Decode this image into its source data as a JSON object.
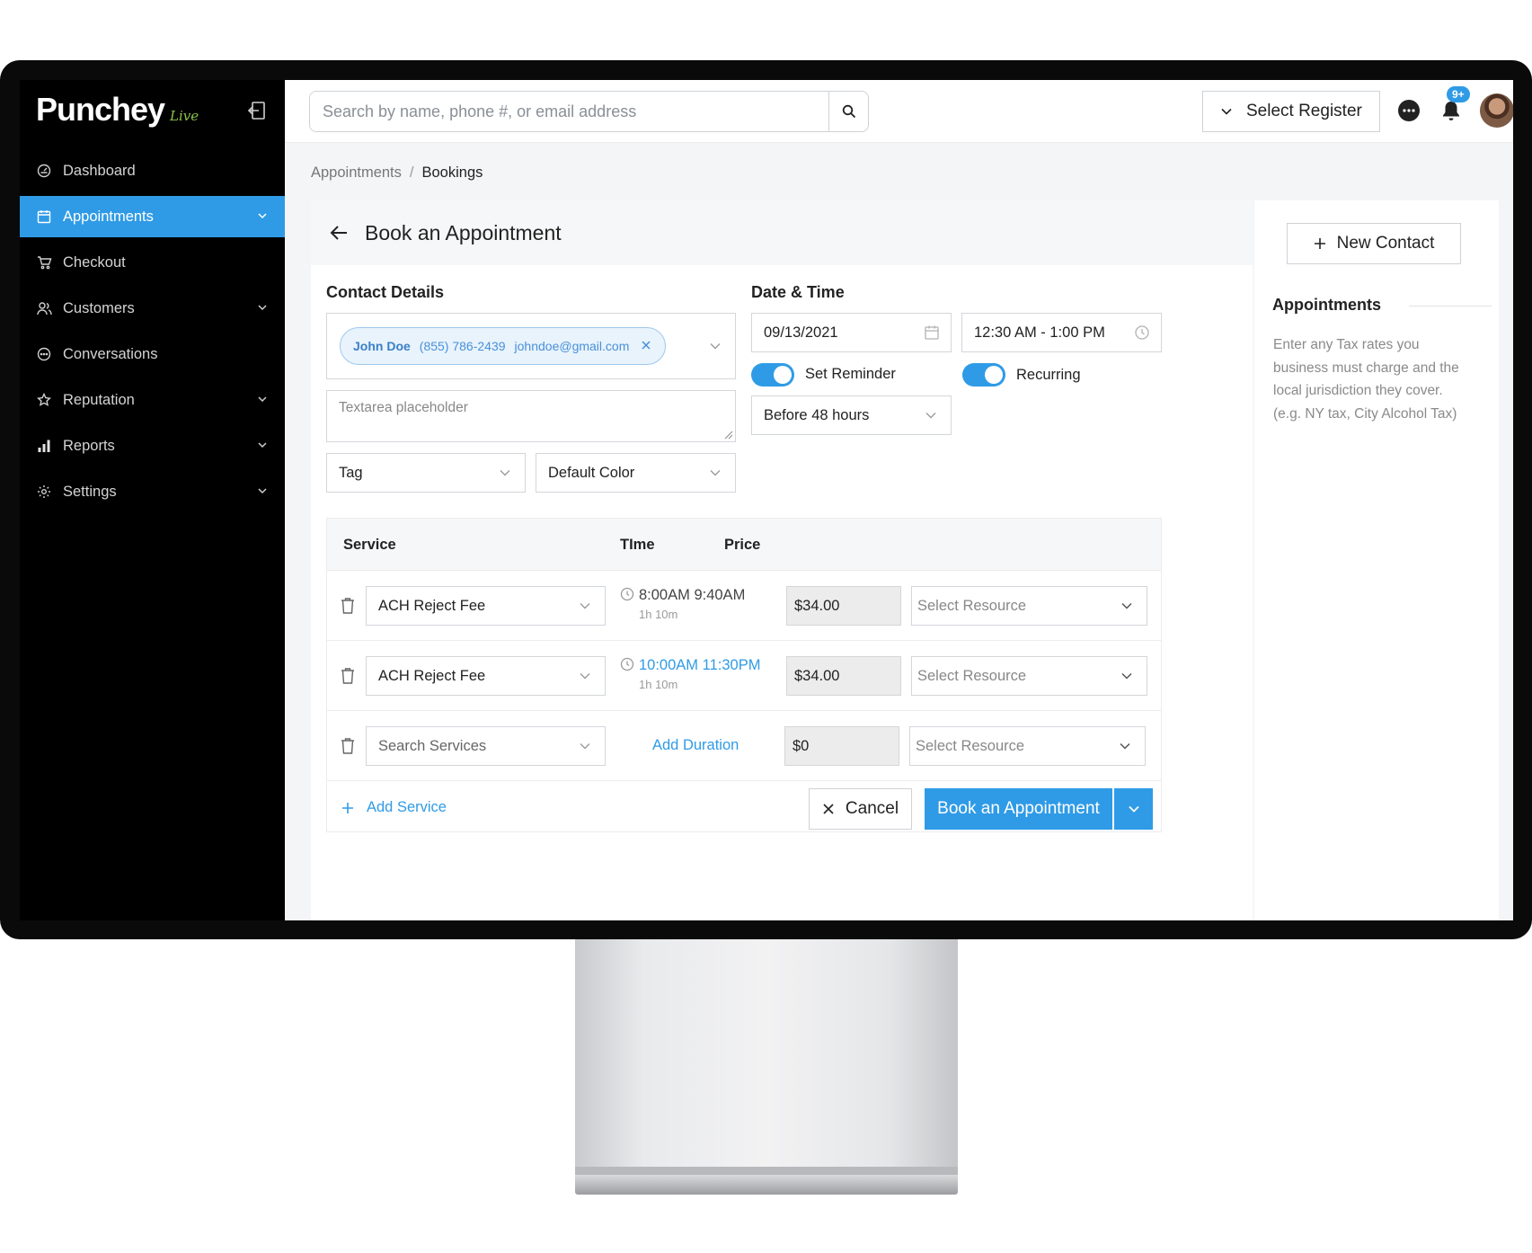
{
  "brand": {
    "name": "Punchey",
    "tag": "Live"
  },
  "sidebar": {
    "items": [
      {
        "label": "Dashboard",
        "icon": "dashboard-icon",
        "active": false,
        "expandable": false
      },
      {
        "label": "Appointments",
        "icon": "calendar-icon",
        "active": true,
        "expandable": true
      },
      {
        "label": "Checkout",
        "icon": "cart-icon",
        "active": false,
        "expandable": false
      },
      {
        "label": "Customers",
        "icon": "users-icon",
        "active": false,
        "expandable": true
      },
      {
        "label": "Conversations",
        "icon": "chat-icon",
        "active": false,
        "expandable": false
      },
      {
        "label": "Reputation",
        "icon": "star-icon",
        "active": false,
        "expandable": true
      },
      {
        "label": "Reports",
        "icon": "bar-chart-icon",
        "active": false,
        "expandable": true
      },
      {
        "label": "Settings",
        "icon": "gear-icon",
        "active": false,
        "expandable": true
      }
    ]
  },
  "topbar": {
    "search_placeholder": "Search by name, phone #, or email address",
    "register_label": "Select Register",
    "notifications_badge": "9+"
  },
  "breadcrumb": {
    "parent": "Appointments",
    "separator": "/",
    "current": "Bookings"
  },
  "page": {
    "title": "Book an Appointment"
  },
  "contact": {
    "section_title": "Contact Details",
    "chip": {
      "name": "John Doe",
      "phone": "(855) 786-2439",
      "email": "johndoe@gmail.com"
    },
    "textarea_placeholder": "Textarea placeholder",
    "tag_label": "Tag",
    "color_label": "Default Color"
  },
  "datetime": {
    "section_title": "Date & Time",
    "date": "09/13/2021",
    "time_range": "12:30 AM - 1:00 PM",
    "set_reminder_label": "Set Reminder",
    "set_reminder_on": true,
    "recurring_label": "Recurring",
    "recurring_on": true,
    "reminder_option": "Before 48 hours"
  },
  "services": {
    "headers": {
      "service": "Service",
      "time": "TIme",
      "price": "Price"
    },
    "rows": [
      {
        "service": "ACH Reject Fee",
        "time": "8:00AM 9:40AM",
        "duration": "1h 10m",
        "price": "$34.00",
        "resource": "Select Resource",
        "highlight": false
      },
      {
        "service": "ACH Reject Fee",
        "time": "10:00AM 11:30PM",
        "duration": "1h 10m",
        "price": "$34.00",
        "resource": "Select Resource",
        "highlight": true
      }
    ],
    "new_row": {
      "service_placeholder": "Search Services",
      "add_duration": "Add Duration",
      "price": "$0",
      "resource": "Select Resource"
    },
    "add_service_label": "Add Service",
    "cancel_label": "Cancel",
    "book_label": "Book an Appointment"
  },
  "right_panel": {
    "new_contact_label": "New Contact",
    "title": "Appointments",
    "description": "Enter any Tax rates you business must charge and the local jurisdiction they cover. (e.g. NY tax, City Alcohol Tax)"
  },
  "colors": {
    "accent": "#2f9be6",
    "sidebar_bg": "#000000",
    "chip_bg": "#e8f3fc",
    "brand_live": "#8bc34a"
  }
}
